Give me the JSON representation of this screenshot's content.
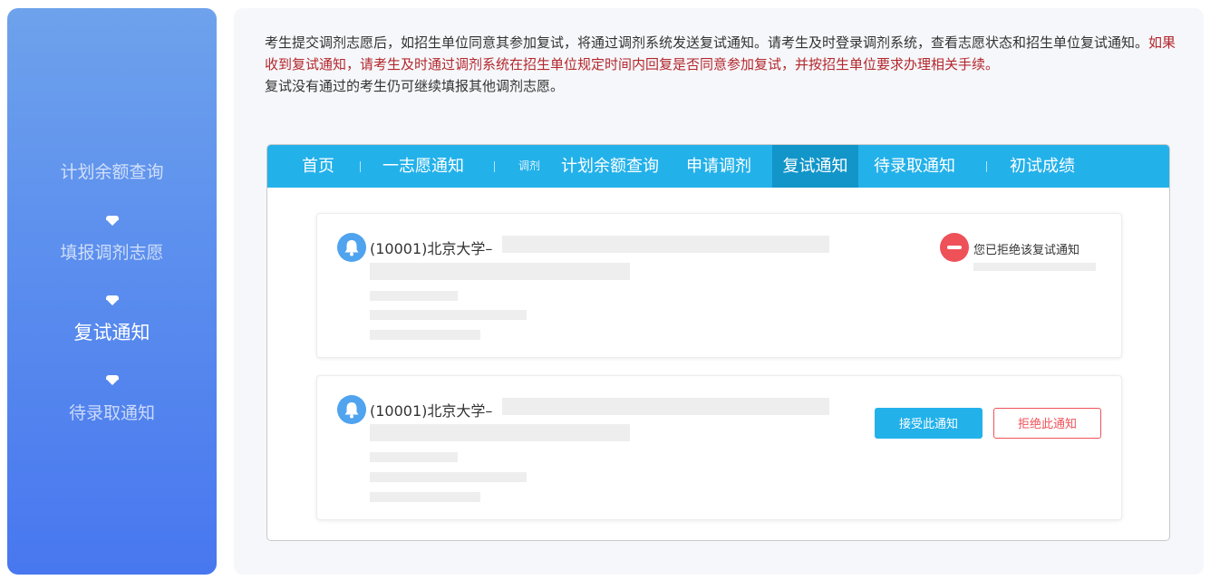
{
  "sidebar": {
    "steps": [
      {
        "label": "计划余额查询"
      },
      {
        "label": "填报调剂志愿"
      },
      {
        "label": "复试通知"
      },
      {
        "label": "待录取通知"
      }
    ]
  },
  "notice": {
    "part1": "考生提交调剂志愿后，如招生单位同意其参加复试，将通过调剂系统发送复试通知。请考生及时登录调剂系统，查看志愿状态和招生单位复试通知。",
    "part2_red": "如果收到复试通知，请考生及时通过调剂系统在招生单位规定时间内回复是否同意参加复试，并按招生单位要求办理相关手续。",
    "part3": "复试没有通过的考生仍可继续填报其他调剂志愿。"
  },
  "nav": {
    "items": [
      "首页",
      "一志愿通知",
      "计划余额查询",
      "申请调剂",
      "复试通知",
      "待录取通知",
      "初试成绩"
    ],
    "small_label": "调剂",
    "active": "复试通知"
  },
  "cards": [
    {
      "university": "(10001)北京大学–",
      "status_text": "您已拒绝该复试通知"
    },
    {
      "university": "(10001)北京大学–",
      "accept_label": "接受此通知",
      "decline_label": "拒绝此通知"
    }
  ],
  "colors": {
    "sidebar_top": "#6ea2ec",
    "sidebar_bottom": "#4877ef",
    "nav_bar": "#23b1ea",
    "nav_active": "#1295c9",
    "notice_red": "#b3272d",
    "reject_red": "#ee5258"
  },
  "icons": [
    "bell-icon",
    "reject-minus-icon",
    "down-arrow-icon"
  ]
}
